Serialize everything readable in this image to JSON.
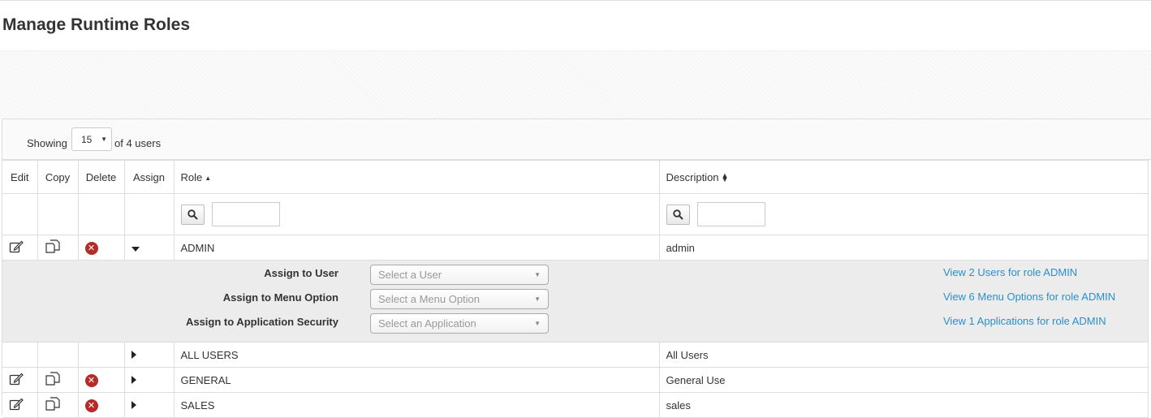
{
  "page": {
    "title": "Manage Runtime Roles"
  },
  "length_menu": {
    "showing_label": "Showing",
    "page_size": "15",
    "of_label": "of 4 users"
  },
  "table": {
    "headers": {
      "edit": "Edit",
      "copy": "Copy",
      "delete": "Delete",
      "assign": "Assign",
      "role": "Role",
      "description": "Description"
    },
    "rows": [
      {
        "role": "ADMIN",
        "description": "admin",
        "has_edit": true,
        "has_copy": true,
        "has_delete": true,
        "expanded": true
      },
      {
        "role": "ALL USERS",
        "description": "All Users",
        "has_edit": false,
        "has_copy": false,
        "has_delete": false,
        "expanded": false
      },
      {
        "role": "GENERAL",
        "description": "General Use",
        "has_edit": true,
        "has_copy": true,
        "has_delete": true,
        "expanded": false
      },
      {
        "role": "SALES",
        "description": "sales",
        "has_edit": true,
        "has_copy": true,
        "has_delete": true,
        "expanded": false
      }
    ]
  },
  "expanded": {
    "assign_user_label": "Assign to User",
    "assign_menu_label": "Assign to Menu Option",
    "assign_app_label": "Assign to Application Security",
    "user_placeholder": "Select a User",
    "menu_placeholder": "Select a Menu Option",
    "app_placeholder": "Select an Application",
    "view_users_link": "View 2 Users for role ADMIN",
    "view_menu_link": "View 6 Menu Options for role ADMIN",
    "view_apps_link": "View 1 Applications for role ADMIN"
  },
  "icons": {
    "edit": "edit-icon",
    "copy": "copy-icon",
    "delete": "delete-icon",
    "expand": "caret-right-icon",
    "collapse": "caret-down-icon",
    "search": "search-icon"
  },
  "colors": {
    "link": "#2a8fc9",
    "delete": "#b52b27",
    "expanded_bg": "#ececec"
  }
}
